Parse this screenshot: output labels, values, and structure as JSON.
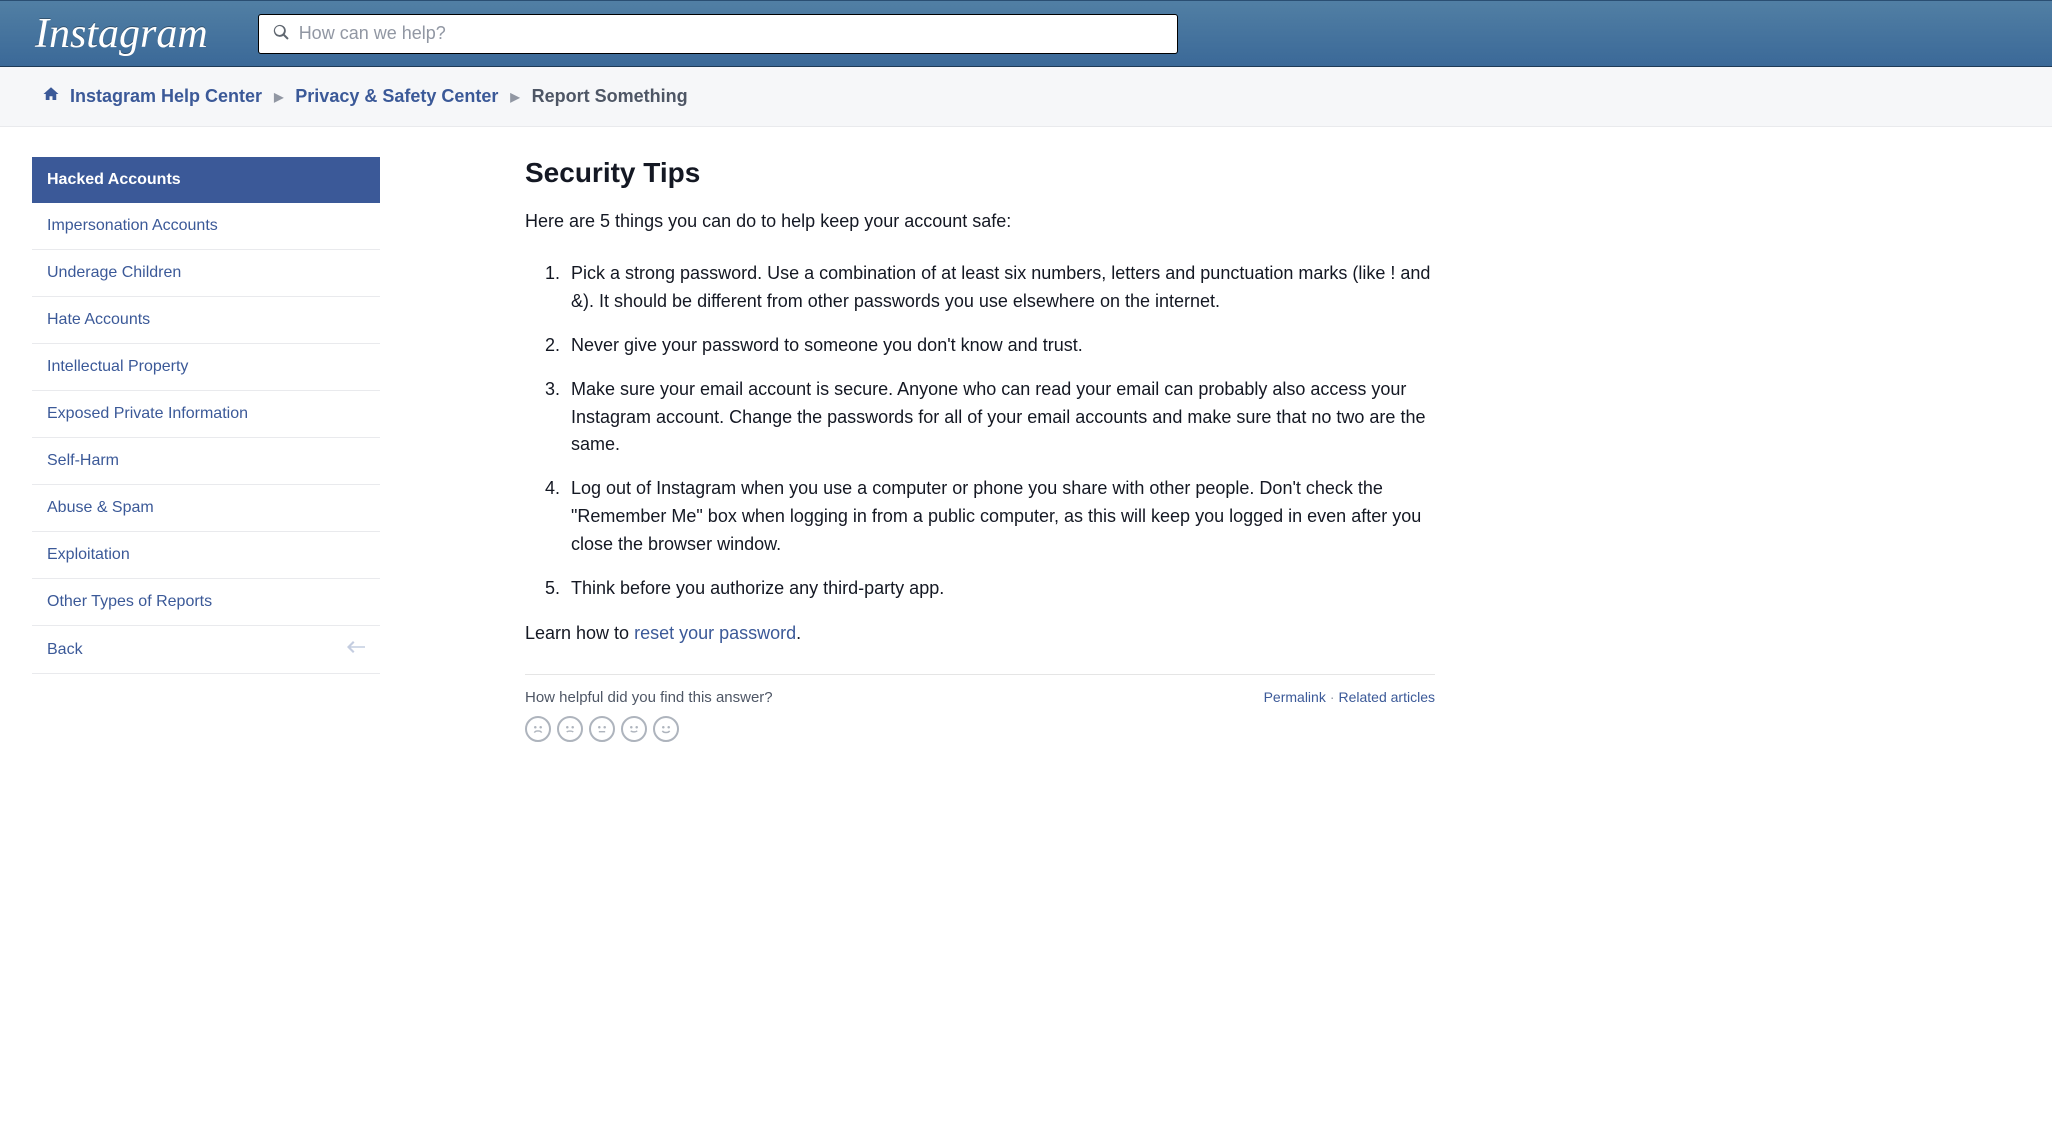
{
  "header": {
    "logo_text": "Instagram",
    "search_placeholder": "How can we help?"
  },
  "breadcrumb": {
    "items": [
      {
        "label": "Instagram Help Center",
        "current": false
      },
      {
        "label": "Privacy & Safety Center",
        "current": false
      },
      {
        "label": "Report Something",
        "current": true
      }
    ]
  },
  "sidebar": {
    "items": [
      {
        "label": "Hacked Accounts",
        "selected": true
      },
      {
        "label": "Impersonation Accounts",
        "selected": false
      },
      {
        "label": "Underage Children",
        "selected": false
      },
      {
        "label": "Hate Accounts",
        "selected": false
      },
      {
        "label": "Intellectual Property",
        "selected": false
      },
      {
        "label": "Exposed Private Information",
        "selected": false
      },
      {
        "label": "Self-Harm",
        "selected": false
      },
      {
        "label": "Abuse & Spam",
        "selected": false
      },
      {
        "label": "Exploitation",
        "selected": false
      },
      {
        "label": "Other Types of Reports",
        "selected": false
      },
      {
        "label": "Back",
        "selected": false,
        "back": true
      }
    ]
  },
  "article": {
    "title": "Security Tips",
    "intro": "Here are 5 things you can do to help keep your account safe:",
    "tips": [
      "Pick a strong password. Use a combination of at least six numbers, letters and punctuation marks (like ! and &). It should be different from other passwords you use elsewhere on the internet.",
      "Never give your password to someone you don't know and trust.",
      "Make sure your email account is secure. Anyone who can read your email can probably also access your Instagram account. Change the passwords for all of your email accounts and make sure that no two are the same.",
      "Log out of Instagram when you use a computer or phone you share with other people. Don't check the \"Remember Me\" box when logging in from a public computer, as this will keep you logged in even after you close the browser window.",
      "Think before you authorize any third-party app."
    ],
    "learn_prefix": "Learn how to ",
    "learn_link_text": "reset your password",
    "learn_suffix": "."
  },
  "feedback": {
    "question": "How helpful did you find this answer?",
    "permalink_label": "Permalink",
    "related_label": "Related articles"
  }
}
